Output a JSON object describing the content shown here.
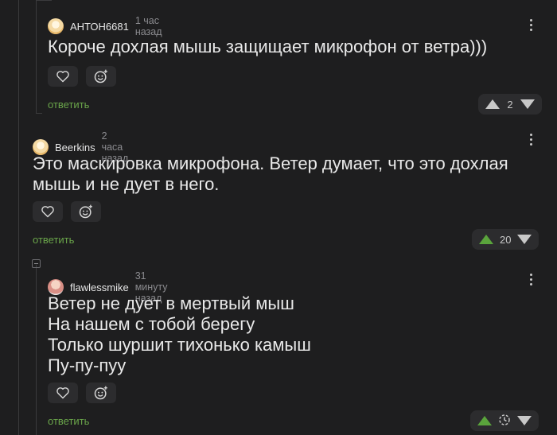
{
  "colors": {
    "background": "#1e1e1f",
    "reply_green": "#6aa54a",
    "upvote_active": "#5aa43c",
    "button_bg": "#2c2c2e"
  },
  "comments": [
    {
      "author": "АНТОН6681",
      "time": "1 час назад",
      "text": "Короче дохлая мышь защищает микрофон от ветра)))",
      "reply_label": "ответить",
      "votes": "2",
      "avatar_icon": "cat-avatar-icon"
    },
    {
      "author": "Beerkins",
      "time": "2 часа назад",
      "text": "Это маскировка микрофона. Ветер думает, что это дохлая мышь и не дует в него.",
      "reply_label": "ответить",
      "votes": "20",
      "avatar_icon": "cat-avatar-icon"
    },
    {
      "author": "flawlessmike",
      "time": "31 минуту назад",
      "text": "Ветер не дует в мертвый мыш\nНа нашем с тобой берегу\nТолько шуршит тихонько камыш\nПу-пу-пуу",
      "reply_label": "ответить",
      "votes": "",
      "avatar_icon": "user-avatar-icon"
    }
  ]
}
